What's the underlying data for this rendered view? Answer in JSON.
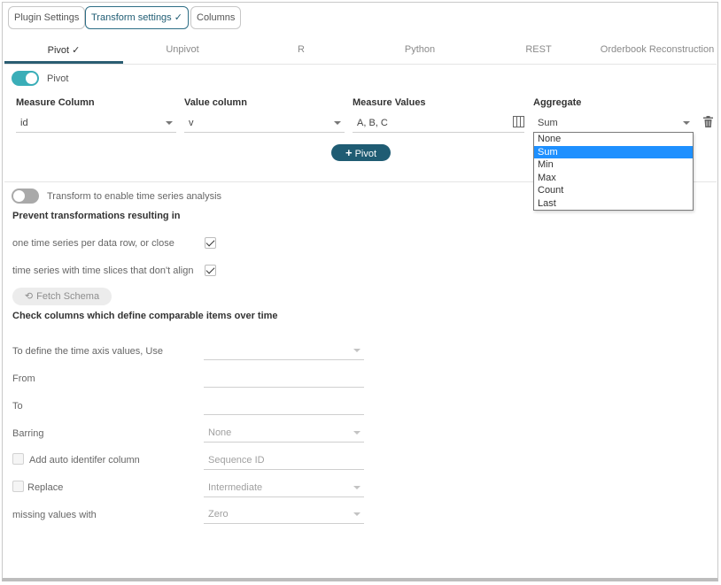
{
  "top_tabs": [
    {
      "label": "Plugin Settings",
      "active": false
    },
    {
      "label": "Transform settings ✓",
      "active": true
    },
    {
      "label": "Columns",
      "active": false
    }
  ],
  "sub_tabs": [
    {
      "label": "Pivot ✓",
      "active": true
    },
    {
      "label": "Unpivot",
      "active": false
    },
    {
      "label": "R",
      "active": false
    },
    {
      "label": "Python",
      "active": false
    },
    {
      "label": "REST",
      "active": false
    },
    {
      "label": "Orderbook Reconstruction",
      "active": false
    }
  ],
  "pivot": {
    "toggle_on": true,
    "toggle_label": "Pivot",
    "headers": {
      "measure_column": "Measure Column",
      "value_column": "Value column",
      "measure_values": "Measure Values",
      "aggregate": "Aggregate"
    },
    "measure_column_value": "id",
    "value_column_value": "v",
    "measure_values_value": "A, B, C",
    "aggregate_value": "Sum",
    "aggregate_options": [
      "None",
      "Sum",
      "Min",
      "Max",
      "Count",
      "Last"
    ],
    "aggregate_selected": "Sum",
    "pivot_button": "Pivot"
  },
  "timeseries": {
    "toggle_on": false,
    "toggle_label": "Transform to enable time series analysis",
    "prevent_heading": "Prevent transformations resulting in",
    "option1_label": "one time series per data row, or close",
    "option1_checked": true,
    "option2_label": "time series with time slices that don't align",
    "option2_checked": true,
    "fetch_schema_label": "Fetch Schema",
    "check_columns_heading": "Check columns which define comparable items over time",
    "time_axis_label": "To define the time axis values, Use",
    "from_label": "From",
    "to_label": "To",
    "barring_label": "Barring",
    "barring_value": "None",
    "auto_id_label": "Add auto identifer column",
    "auto_id_value": "Sequence ID",
    "replace_label": "Replace",
    "replace_value": "Intermediate",
    "missing_label": "missing values with",
    "missing_value": "Zero"
  },
  "colors": {
    "accent": "#1f5c73",
    "toggle_on": "#3aaeb8",
    "selection": "#1e90ff"
  }
}
